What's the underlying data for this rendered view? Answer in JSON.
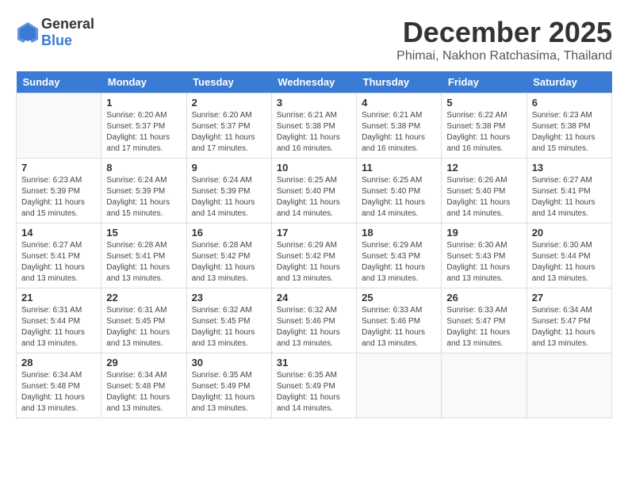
{
  "header": {
    "logo": {
      "general": "General",
      "blue": "Blue"
    },
    "title": "December 2025",
    "subtitle": "Phimai, Nakhon Ratchasima, Thailand"
  },
  "calendar": {
    "weekdays": [
      "Sunday",
      "Monday",
      "Tuesday",
      "Wednesday",
      "Thursday",
      "Friday",
      "Saturday"
    ],
    "weeks": [
      [
        {
          "day": "",
          "sunrise": "",
          "sunset": "",
          "daylight": ""
        },
        {
          "day": "1",
          "sunrise": "Sunrise: 6:20 AM",
          "sunset": "Sunset: 5:37 PM",
          "daylight": "Daylight: 11 hours and 17 minutes."
        },
        {
          "day": "2",
          "sunrise": "Sunrise: 6:20 AM",
          "sunset": "Sunset: 5:37 PM",
          "daylight": "Daylight: 11 hours and 17 minutes."
        },
        {
          "day": "3",
          "sunrise": "Sunrise: 6:21 AM",
          "sunset": "Sunset: 5:38 PM",
          "daylight": "Daylight: 11 hours and 16 minutes."
        },
        {
          "day": "4",
          "sunrise": "Sunrise: 6:21 AM",
          "sunset": "Sunset: 5:38 PM",
          "daylight": "Daylight: 11 hours and 16 minutes."
        },
        {
          "day": "5",
          "sunrise": "Sunrise: 6:22 AM",
          "sunset": "Sunset: 5:38 PM",
          "daylight": "Daylight: 11 hours and 16 minutes."
        },
        {
          "day": "6",
          "sunrise": "Sunrise: 6:23 AM",
          "sunset": "Sunset: 5:38 PM",
          "daylight": "Daylight: 11 hours and 15 minutes."
        }
      ],
      [
        {
          "day": "7",
          "sunrise": "Sunrise: 6:23 AM",
          "sunset": "Sunset: 5:39 PM",
          "daylight": "Daylight: 11 hours and 15 minutes."
        },
        {
          "day": "8",
          "sunrise": "Sunrise: 6:24 AM",
          "sunset": "Sunset: 5:39 PM",
          "daylight": "Daylight: 11 hours and 15 minutes."
        },
        {
          "day": "9",
          "sunrise": "Sunrise: 6:24 AM",
          "sunset": "Sunset: 5:39 PM",
          "daylight": "Daylight: 11 hours and 14 minutes."
        },
        {
          "day": "10",
          "sunrise": "Sunrise: 6:25 AM",
          "sunset": "Sunset: 5:40 PM",
          "daylight": "Daylight: 11 hours and 14 minutes."
        },
        {
          "day": "11",
          "sunrise": "Sunrise: 6:25 AM",
          "sunset": "Sunset: 5:40 PM",
          "daylight": "Daylight: 11 hours and 14 minutes."
        },
        {
          "day": "12",
          "sunrise": "Sunrise: 6:26 AM",
          "sunset": "Sunset: 5:40 PM",
          "daylight": "Daylight: 11 hours and 14 minutes."
        },
        {
          "day": "13",
          "sunrise": "Sunrise: 6:27 AM",
          "sunset": "Sunset: 5:41 PM",
          "daylight": "Daylight: 11 hours and 14 minutes."
        }
      ],
      [
        {
          "day": "14",
          "sunrise": "Sunrise: 6:27 AM",
          "sunset": "Sunset: 5:41 PM",
          "daylight": "Daylight: 11 hours and 13 minutes."
        },
        {
          "day": "15",
          "sunrise": "Sunrise: 6:28 AM",
          "sunset": "Sunset: 5:41 PM",
          "daylight": "Daylight: 11 hours and 13 minutes."
        },
        {
          "day": "16",
          "sunrise": "Sunrise: 6:28 AM",
          "sunset": "Sunset: 5:42 PM",
          "daylight": "Daylight: 11 hours and 13 minutes."
        },
        {
          "day": "17",
          "sunrise": "Sunrise: 6:29 AM",
          "sunset": "Sunset: 5:42 PM",
          "daylight": "Daylight: 11 hours and 13 minutes."
        },
        {
          "day": "18",
          "sunrise": "Sunrise: 6:29 AM",
          "sunset": "Sunset: 5:43 PM",
          "daylight": "Daylight: 11 hours and 13 minutes."
        },
        {
          "day": "19",
          "sunrise": "Sunrise: 6:30 AM",
          "sunset": "Sunset: 5:43 PM",
          "daylight": "Daylight: 11 hours and 13 minutes."
        },
        {
          "day": "20",
          "sunrise": "Sunrise: 6:30 AM",
          "sunset": "Sunset: 5:44 PM",
          "daylight": "Daylight: 11 hours and 13 minutes."
        }
      ],
      [
        {
          "day": "21",
          "sunrise": "Sunrise: 6:31 AM",
          "sunset": "Sunset: 5:44 PM",
          "daylight": "Daylight: 11 hours and 13 minutes."
        },
        {
          "day": "22",
          "sunrise": "Sunrise: 6:31 AM",
          "sunset": "Sunset: 5:45 PM",
          "daylight": "Daylight: 11 hours and 13 minutes."
        },
        {
          "day": "23",
          "sunrise": "Sunrise: 6:32 AM",
          "sunset": "Sunset: 5:45 PM",
          "daylight": "Daylight: 11 hours and 13 minutes."
        },
        {
          "day": "24",
          "sunrise": "Sunrise: 6:32 AM",
          "sunset": "Sunset: 5:46 PM",
          "daylight": "Daylight: 11 hours and 13 minutes."
        },
        {
          "day": "25",
          "sunrise": "Sunrise: 6:33 AM",
          "sunset": "Sunset: 5:46 PM",
          "daylight": "Daylight: 11 hours and 13 minutes."
        },
        {
          "day": "26",
          "sunrise": "Sunrise: 6:33 AM",
          "sunset": "Sunset: 5:47 PM",
          "daylight": "Daylight: 11 hours and 13 minutes."
        },
        {
          "day": "27",
          "sunrise": "Sunrise: 6:34 AM",
          "sunset": "Sunset: 5:47 PM",
          "daylight": "Daylight: 11 hours and 13 minutes."
        }
      ],
      [
        {
          "day": "28",
          "sunrise": "Sunrise: 6:34 AM",
          "sunset": "Sunset: 5:48 PM",
          "daylight": "Daylight: 11 hours and 13 minutes."
        },
        {
          "day": "29",
          "sunrise": "Sunrise: 6:34 AM",
          "sunset": "Sunset: 5:48 PM",
          "daylight": "Daylight: 11 hours and 13 minutes."
        },
        {
          "day": "30",
          "sunrise": "Sunrise: 6:35 AM",
          "sunset": "Sunset: 5:49 PM",
          "daylight": "Daylight: 11 hours and 13 minutes."
        },
        {
          "day": "31",
          "sunrise": "Sunrise: 6:35 AM",
          "sunset": "Sunset: 5:49 PM",
          "daylight": "Daylight: 11 hours and 14 minutes."
        },
        {
          "day": "",
          "sunrise": "",
          "sunset": "",
          "daylight": ""
        },
        {
          "day": "",
          "sunrise": "",
          "sunset": "",
          "daylight": ""
        },
        {
          "day": "",
          "sunrise": "",
          "sunset": "",
          "daylight": ""
        }
      ]
    ]
  }
}
